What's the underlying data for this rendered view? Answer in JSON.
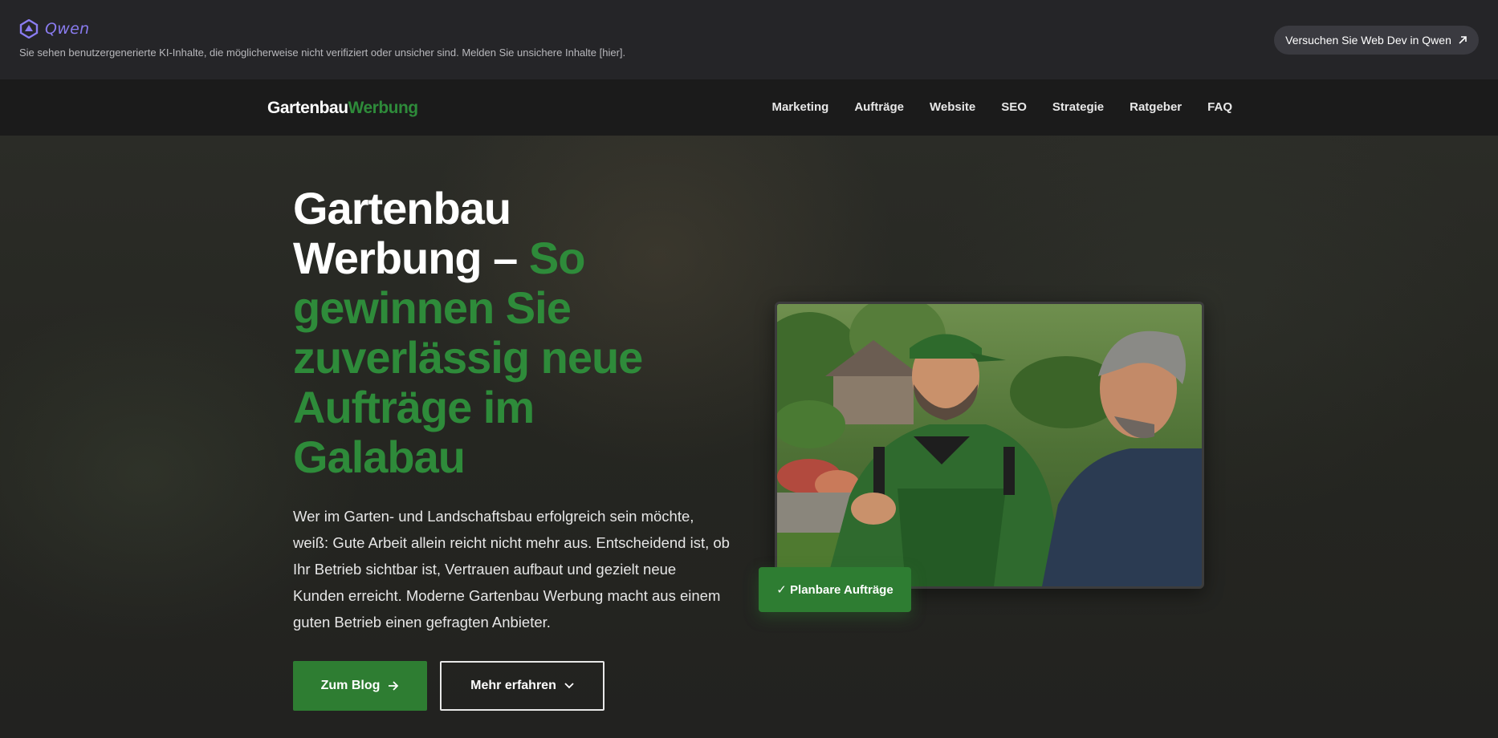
{
  "banner": {
    "logo_text": "Qwen",
    "notice": "Sie sehen benutzergenerierte KI-Inhalte, die möglicherweise nicht verifiziert oder unsicher sind. Melden Sie unsichere Inhalte [hier].",
    "try_button": "Versuchen Sie Web Dev in Qwen"
  },
  "nav": {
    "brand_part1": "Gartenbau",
    "brand_part2": "Werbung",
    "items": [
      "Marketing",
      "Aufträge",
      "Website",
      "SEO",
      "Strategie",
      "Ratgeber",
      "FAQ"
    ]
  },
  "hero": {
    "title_white": "Gartenbau Werbung – ",
    "title_green": "So gewinnen Sie zuverlässig neue Aufträge im Galabau",
    "text": "Wer im Garten- und Landschaftsbau erfolgreich sein möchte, weiß: Gute Arbeit allein reicht nicht mehr aus. Entscheidend ist, ob Ihr Betrieb sichtbar ist, Vertrauen aufbaut und gezielt neue Kunden erreicht. Moderne Gartenbau Werbung macht aus einem guten Betrieb einen gefragten Anbieter.",
    "btn_blog": "Zum Blog",
    "btn_more": "Mehr erfahren",
    "badge": "✓ Planbare Aufträge"
  },
  "colors": {
    "accent_green": "#2e7d32",
    "brand_green": "#2e8b3a",
    "qwen_purple": "#8a7cf0"
  }
}
